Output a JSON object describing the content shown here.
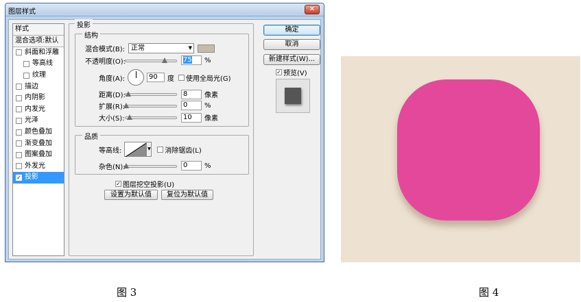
{
  "dialog": {
    "title": "图层样式",
    "close_label": "✕",
    "style_list": {
      "header": "样式",
      "blend_default": "混合选项:默认",
      "items": [
        {
          "label": "斜面和浮雕",
          "checked": false,
          "indent": false,
          "selected": false
        },
        {
          "label": "等高线",
          "checked": false,
          "indent": true,
          "selected": false
        },
        {
          "label": "纹理",
          "checked": false,
          "indent": true,
          "selected": false
        },
        {
          "label": "描边",
          "checked": false,
          "indent": false,
          "selected": false
        },
        {
          "label": "内阴影",
          "checked": false,
          "indent": false,
          "selected": false
        },
        {
          "label": "内发光",
          "checked": false,
          "indent": false,
          "selected": false
        },
        {
          "label": "光泽",
          "checked": false,
          "indent": false,
          "selected": false
        },
        {
          "label": "颜色叠加",
          "checked": false,
          "indent": false,
          "selected": false
        },
        {
          "label": "渐变叠加",
          "checked": false,
          "indent": false,
          "selected": false
        },
        {
          "label": "图案叠加",
          "checked": false,
          "indent": false,
          "selected": false
        },
        {
          "label": "外发光",
          "checked": false,
          "indent": false,
          "selected": false
        },
        {
          "label": "投影",
          "checked": true,
          "indent": false,
          "selected": true
        }
      ]
    },
    "panel": {
      "group_title": "投影",
      "structure": {
        "title": "结构",
        "blend_mode_label": "混合模式(B):",
        "blend_mode_value": "正常",
        "shadow_color": "#c3bcaa",
        "opacity_label": "不透明度(O):",
        "opacity_value": "75",
        "opacity_unit": "%",
        "angle_label": "角度(A):",
        "angle_value": "90",
        "angle_unit": "度",
        "global_light_label": "使用全局光(G)",
        "global_light_checked": false,
        "distance_label": "距离(D):",
        "distance_value": "8",
        "distance_unit": "像素",
        "spread_label": "扩展(R):",
        "spread_value": "0",
        "spread_unit": "%",
        "size_label": "大小(S):",
        "size_value": "10",
        "size_unit": "像素"
      },
      "quality": {
        "title": "品质",
        "contour_label": "等高线:",
        "antialias_label": "消除锯齿(L)",
        "antialias_checked": false,
        "noise_label": "杂色(N):",
        "noise_value": "0",
        "noise_unit": "%"
      },
      "knockout_label": "图层挖空投影(U)",
      "knockout_checked": true,
      "make_default_label": "设置为默认值",
      "reset_default_label": "复位为默认值"
    },
    "buttons": {
      "ok": "确定",
      "cancel": "取消",
      "new_style": "新建样式(W)...",
      "preview_label": "预览(V)",
      "preview_checked": true
    }
  },
  "figure4": {
    "background_color": "#ede2d1",
    "shape_color": "#e4489a"
  },
  "captions": {
    "fig3": "图 3",
    "fig4": "图 4"
  }
}
